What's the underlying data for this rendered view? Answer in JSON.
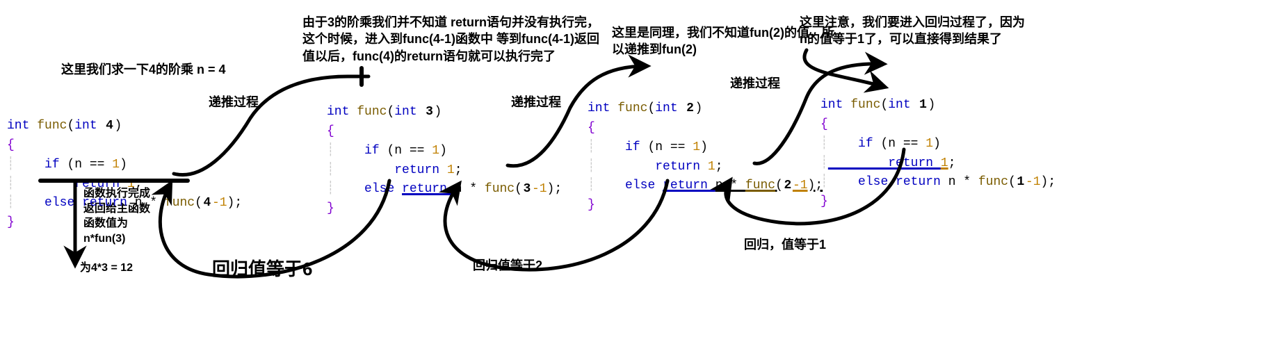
{
  "captions": {
    "top1": "这里我们求一下4的阶乘 n = 4",
    "proc1": "递推过程",
    "top2": "由于3的阶乘我们并不知道 return语句并没有执行完，\n这个时候，进入到func(4-1)函数中 等到func(4-1)返回\n值以后，func(4)的return语句就可以执行完了",
    "proc2": "递推过程",
    "top3": "这里是同理，我们不知道fun(2)的值，所\n以递推到fun(2)",
    "proc3": "递推过程",
    "top4": "这里注意，我们要进入回归过程了，因为\nn的值等于1了，可以直接得到结果了",
    "ret_note": "函数执行完成\n返回给主函数\n函数值为\nn*fun(3)",
    "ret_val1": "为4*3 = 12",
    "big_ret6": "回归值等于6",
    "ret2": "回归值等于2",
    "ret1": "回归，值等于1"
  },
  "code": {
    "sig_prefix": "int ",
    "sig_func": "func",
    "sig_open": "(",
    "sig_int": "int ",
    "sig_close": ")",
    "lbrace": "{",
    "if_line_a": "    if ",
    "if_line_b": "(n == ",
    "if_line_c": "1",
    "if_line_d": ")",
    "ret1_a": "        return ",
    "ret1_b": "1",
    "ret1_c": ";",
    "else_a": "    else ",
    "else_ret": "return ",
    "else_n": "n ",
    "else_star": "* ",
    "else_fn": "func",
    "else_open": "(",
    "else_minus": "-1",
    "else_close": ");",
    "rbrace": "}",
    "marks": {
      "n4": "4",
      "n3": "3",
      "n2": "2",
      "n1": "1"
    }
  }
}
